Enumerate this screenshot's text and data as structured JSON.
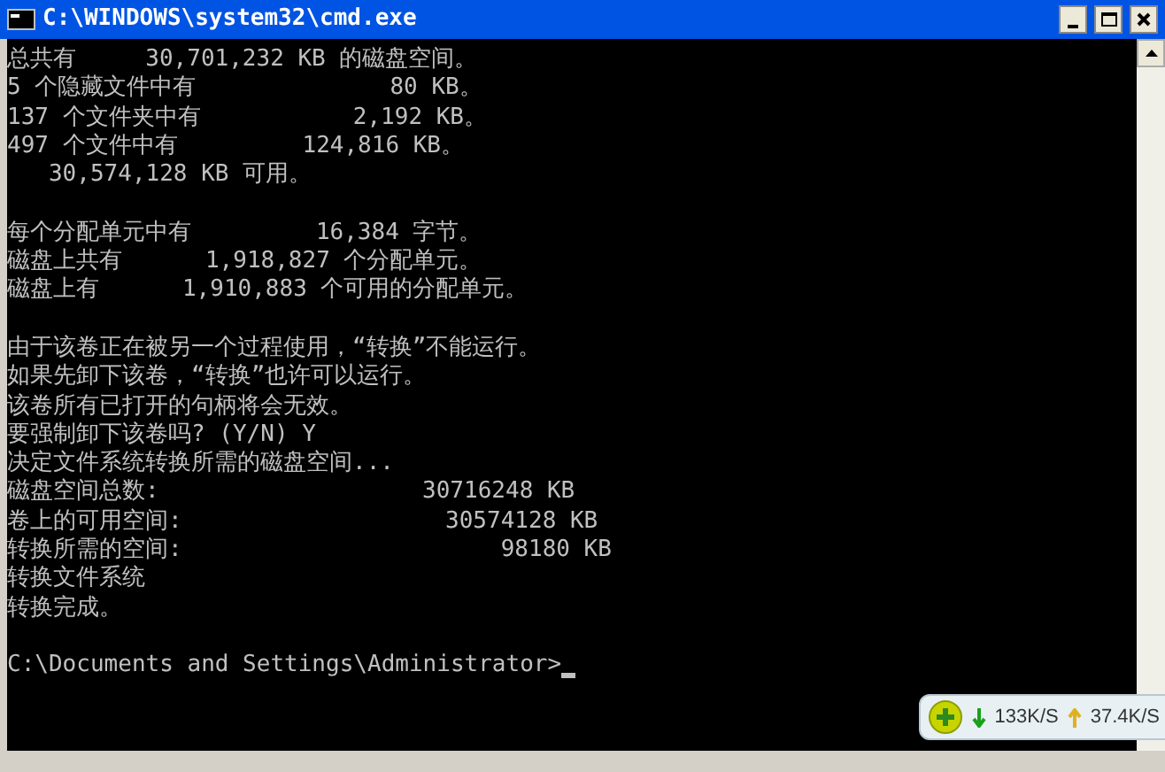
{
  "window": {
    "title": "C:\\WINDOWS\\system32\\cmd.exe"
  },
  "console_blocks": [
    [
      "总共有     30,701,232 KB 的磁盘空间。",
      "5 个隐藏文件中有              80 KB。",
      "137 个文件夹中有           2,192 KB。",
      "497 个文件中有         124,816 KB。",
      "   30,574,128 KB 可用。"
    ],
    [
      "每个分配单元中有         16,384 字节。",
      "磁盘上共有      1,918,827 个分配单元。",
      "磁盘上有      1,910,883 个可用的分配单元。"
    ],
    [
      "由于该卷正在被另一个过程使用，“转换”不能运行。",
      "如果先卸下该卷，“转换”也许可以运行。",
      "该卷所有已打开的句柄将会无效。",
      "要强制卸下该卷吗? (Y/N) Y",
      "决定文件系统转换所需的磁盘空间...",
      "磁盘空间总数:                   30716248 KB",
      "卷上的可用空间:                   30574128 KB",
      "转换所需的空间:                       98180 KB",
      "转换文件系统",
      "转换完成。"
    ],
    [
      "C:\\Documents and Settings\\Administrator>"
    ]
  ],
  "speed_widget": {
    "download": "133K/S",
    "upload": "37.4K/S"
  }
}
